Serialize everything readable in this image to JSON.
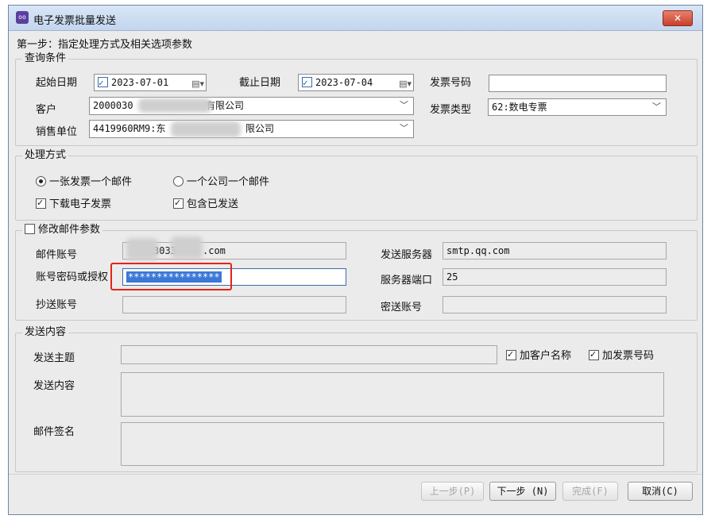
{
  "window": {
    "title": "电子发票批量发送",
    "app_icon_text": "oo",
    "close_glyph": "✕"
  },
  "step_text": "第一步：指定处理方式及相关选项参数",
  "query": {
    "legend": "查询条件",
    "start_date_label": "起始日期",
    "start_date": "2023-07-01",
    "end_date_label": "截止日期",
    "end_date": "2023-07-04",
    "invoice_no_label": "发票号码",
    "invoice_no_value": "",
    "customer_label": "客户",
    "customer_prefix": "2000030",
    "customer_suffix": "有限公司",
    "invoice_type_label": "发票类型",
    "invoice_type_value": "62:数电专票",
    "seller_label": "销售单位",
    "seller_prefix": "4419960RM9:东",
    "seller_suffix": "限公司"
  },
  "method": {
    "legend": "处理方式",
    "radio1_label": "一张发票一个邮件",
    "radio1_checked": true,
    "radio2_label": "一个公司一个邮件",
    "radio2_checked": false,
    "download_label": "下载电子发票",
    "download_checked": true,
    "include_sent_label": "包含已发送",
    "include_sent_checked": true
  },
  "mail": {
    "legend": "修改邮件参数",
    "modify_checked": false,
    "account_label": "邮件账号",
    "account_visible_mid": "3033",
    "account_visible_end": ".com",
    "password_label": "账号密码或授权",
    "password_value": "****************",
    "cc_label": "抄送账号",
    "cc_value": "",
    "server_label": "发送服务器",
    "server_value": "smtp.qq.com",
    "port_label": "服务器端口",
    "port_value": "25",
    "bcc_label": "密送账号",
    "bcc_value": ""
  },
  "content": {
    "legend": "发送内容",
    "subject_label": "发送主题",
    "add_customer_label": "加客户名称",
    "add_customer_checked": true,
    "add_invoice_label": "加发票号码",
    "add_invoice_checked": true,
    "body_label": "发送内容",
    "signature_label": "邮件签名"
  },
  "buttons": {
    "prev": "上一步(P)",
    "next": "下一步 (N)",
    "finish": "完成(F)",
    "cancel": "取消(C)"
  },
  "colors": {
    "highlight_frame": "#e2231a",
    "selection": "#3b78d8",
    "title_bar": "#c3d6ee"
  }
}
